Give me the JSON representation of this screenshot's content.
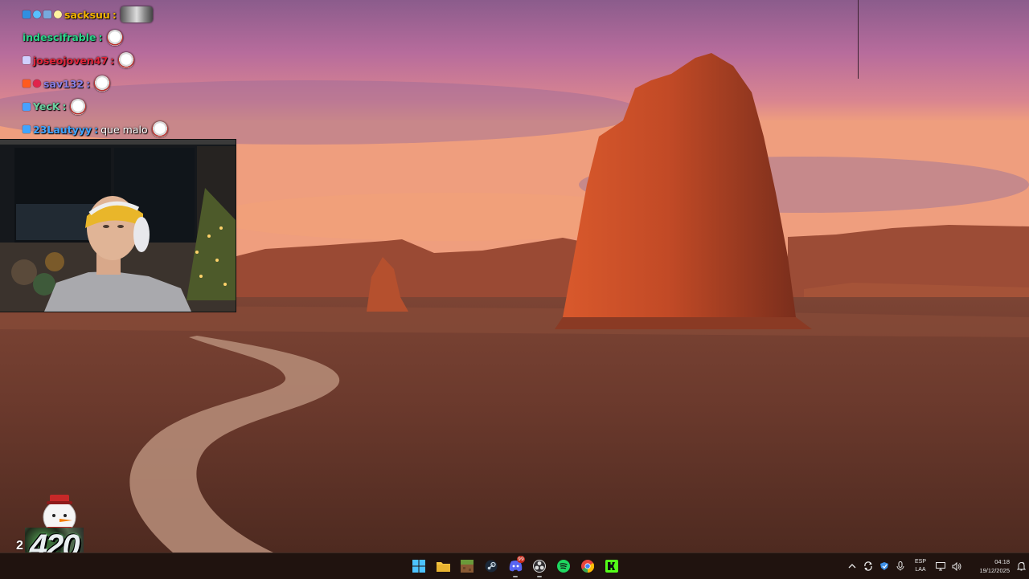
{
  "chat": {
    "messages": [
      {
        "user": "sacksuu",
        "user_color": "#f4b400",
        "text": "",
        "badges": [
          "#2f8fe0",
          "#58c0ff",
          "#7ad",
          "#fff3a0"
        ],
        "emote": "car-emote",
        "emote_wide": true
      },
      {
        "user": "indescifrable",
        "user_color": "#2bd38a",
        "text": "",
        "badges": [],
        "emote": "snowman-emote",
        "emote_wide": false
      },
      {
        "user": "joseojoven47",
        "user_color": "#e0243a",
        "text": "",
        "badges": [
          "#d0d0ff"
        ],
        "emote": "snowman-emote",
        "emote_wide": false
      },
      {
        "user": "sav132",
        "user_color": "#8a7fe6",
        "text": "",
        "badges": [
          "#ff5a1f",
          "#e0244c"
        ],
        "emote": "snowman-emote",
        "emote_wide": false
      },
      {
        "user": "YecK",
        "user_color": "#6ad0a0",
        "text": "",
        "badges": [
          "#48a0ff"
        ],
        "emote": "snowman-emote",
        "emote_wide": false
      },
      {
        "user": "23Lautyyy",
        "user_color": "#3fa4ff",
        "text": "que malo",
        "badges": [
          "#3fa4ff"
        ],
        "emote": "santa-emote",
        "emote_wide": false
      }
    ]
  },
  "counter": {
    "prefix": "2",
    "value": "420"
  },
  "taskbar": {
    "apps": [
      {
        "name": "start",
        "icon": "windows-icon",
        "color": "#4cc2ff",
        "active": false,
        "badge": ""
      },
      {
        "name": "file-explorer",
        "icon": "folder-icon",
        "color": "#f4c542",
        "active": false,
        "badge": ""
      },
      {
        "name": "minecraft",
        "icon": "grass-block-icon",
        "color": "#6a9a3a",
        "active": false,
        "badge": ""
      },
      {
        "name": "steam",
        "icon": "steam-icon",
        "color": "#c7d5e0",
        "active": false,
        "badge": ""
      },
      {
        "name": "discord",
        "icon": "discord-icon",
        "color": "#5865f2",
        "active": true,
        "badge": "99"
      },
      {
        "name": "obs",
        "icon": "obs-icon",
        "color": "#dddddd",
        "active": true,
        "badge": ""
      },
      {
        "name": "spotify",
        "icon": "spotify-icon",
        "color": "#1ed760",
        "active": false,
        "badge": ""
      },
      {
        "name": "chrome",
        "icon": "chrome-icon",
        "color": "#e8453c",
        "active": false,
        "badge": ""
      },
      {
        "name": "kick",
        "icon": "kick-icon",
        "color": "#53fc18",
        "active": false,
        "badge": ""
      }
    ],
    "tray": {
      "language_line1": "ESP",
      "language_line2": "LAA",
      "time": "04:18",
      "date": "19/12/2025"
    }
  }
}
